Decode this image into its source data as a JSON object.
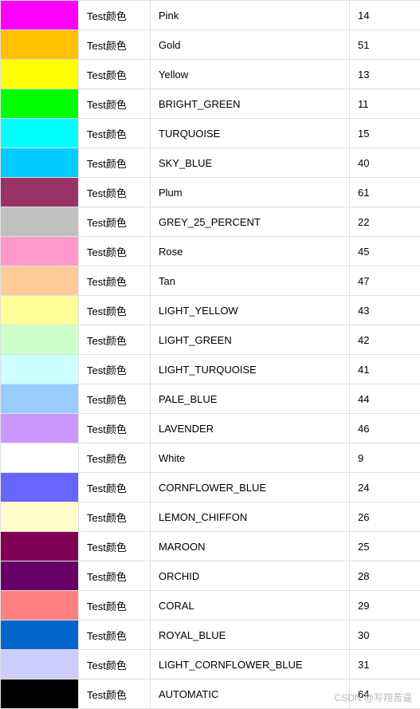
{
  "label_text": "Test颜色",
  "watermark": "CSDN @写翔苦逼",
  "rows": [
    {
      "color": "#FF00FF",
      "name": "Pink",
      "code": "14"
    },
    {
      "color": "#FFC000",
      "name": "Gold",
      "code": "51"
    },
    {
      "color": "#FFFF00",
      "name": "Yellow",
      "code": "13"
    },
    {
      "color": "#00FF00",
      "name": "BRIGHT_GREEN",
      "code": "11"
    },
    {
      "color": "#00FFFF",
      "name": "TURQUOISE",
      "code": "15"
    },
    {
      "color": "#00CCFF",
      "name": "SKY_BLUE",
      "code": "40"
    },
    {
      "color": "#993366",
      "name": "Plum",
      "code": "61"
    },
    {
      "color": "#C0C0C0",
      "name": "GREY_25_PERCENT",
      "code": "22"
    },
    {
      "color": "#FF99CC",
      "name": "Rose",
      "code": "45"
    },
    {
      "color": "#FFCC99",
      "name": "Tan",
      "code": "47"
    },
    {
      "color": "#FFFF99",
      "name": "LIGHT_YELLOW",
      "code": "43"
    },
    {
      "color": "#CCFFCC",
      "name": "LIGHT_GREEN",
      "code": "42"
    },
    {
      "color": "#CCFFFF",
      "name": "LIGHT_TURQUOISE",
      "code": "41"
    },
    {
      "color": "#99CCFF",
      "name": "PALE_BLUE",
      "code": "44"
    },
    {
      "color": "#CC99FF",
      "name": "LAVENDER",
      "code": "46"
    },
    {
      "color": "#FFFFFF",
      "name": "White",
      "code": "9"
    },
    {
      "color": "#6666FF",
      "name": "CORNFLOWER_BLUE",
      "code": "24"
    },
    {
      "color": "#FFFFCC",
      "name": "LEMON_CHIFFON",
      "code": "26"
    },
    {
      "color": "#7F0055",
      "name": "MAROON",
      "code": "25"
    },
    {
      "color": "#660066",
      "name": "ORCHID",
      "code": "28"
    },
    {
      "color": "#FF8080",
      "name": "CORAL",
      "code": "29"
    },
    {
      "color": "#0066CC",
      "name": "ROYAL_BLUE",
      "code": "30"
    },
    {
      "color": "#CCCCFF",
      "name": "LIGHT_CORNFLOWER_BLUE",
      "code": "31"
    },
    {
      "color": "#000000",
      "name": "AUTOMATIC",
      "code": "64"
    }
  ]
}
